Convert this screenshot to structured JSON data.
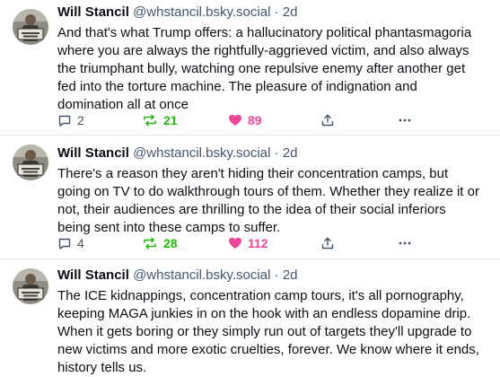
{
  "posts": [
    {
      "author": "Will Stancil",
      "handle": "@whstancil.bsky.social",
      "separator": "·",
      "age": "2d",
      "text": "And that's what Trump offers: a hallucinatory political phantasmagoria\nwhere you are always the rightfully-aggrieved victim, and also always\nthe triumphant bully, watching one repulsive enemy after another get\nfed into the torture machine. The pleasure of indignation and\ndomination all at once",
      "replies": "2",
      "reposts": "21",
      "likes": "89"
    },
    {
      "author": "Will Stancil",
      "handle": "@whstancil.bsky.social",
      "separator": "·",
      "age": "2d",
      "text": "There's a reason they aren't hiding their concentration camps, but\ngoing on TV to do walkthrough tours of them. Whether they realize it or\nnot, their audiences are thrilling to the idea of their social inferiors\nbeing sent into these camps to suffer.",
      "replies": "4",
      "reposts": "28",
      "likes": "112"
    },
    {
      "author": "Will Stancil",
      "handle": "@whstancil.bsky.social",
      "separator": "·",
      "age": "2d",
      "text": "The ICE kidnappings, concentration camp tours, it's all pornography,\nkeeping MAGA junkies in on the hook with an endless dopamine drip.\nWhen it gets boring or they simply run out of targets they'll upgrade to\nnew victims and more exotic cruelties, forever. We know where it ends,\nhistory tells us."
    }
  ],
  "colors": {
    "repost": "#20bc07",
    "like": "#ec4899",
    "muted": "#42576c",
    "divider": "#e4e8ec"
  },
  "icons": {
    "reply": "speech-bubble-icon",
    "repost": "repost-arrows-icon",
    "like": "heart-filled-icon",
    "share": "share-upload-icon",
    "more": "more-dots-icon"
  }
}
